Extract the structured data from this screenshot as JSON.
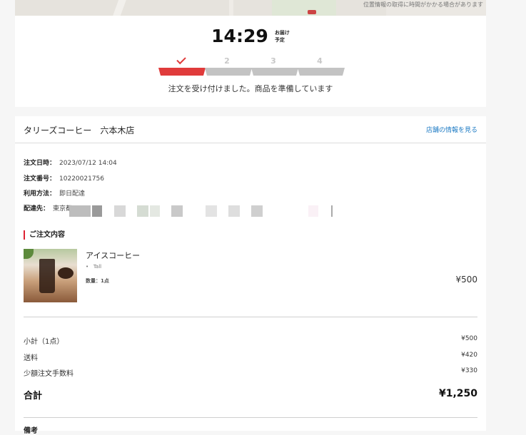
{
  "map": {
    "notice": "位置情報の取得に時間がかかる場合があります"
  },
  "status": {
    "time": "14:29",
    "time_note_1": "お届け",
    "time_note_2": "予定",
    "steps": [
      {
        "label": "✓",
        "active": true
      },
      {
        "label": "2",
        "active": false
      },
      {
        "label": "3",
        "active": false
      },
      {
        "label": "4",
        "active": false
      }
    ],
    "message": "注文を受け付けました。商品を準備しています"
  },
  "store": {
    "name": "タリーズコーヒー　六本木店",
    "link": "店舗の情報を見る"
  },
  "order_info": {
    "date_label": "注文日時：",
    "date_value": "2023/07/12 14:04",
    "number_label": "注文番号：",
    "number_value": "10220021756",
    "method_label": "利用方法：",
    "method_value": "即日配達",
    "address_label": "配達先：",
    "address_value": "東京都"
  },
  "items_section": {
    "title": "ご注文内容",
    "items": [
      {
        "name": "アイスコーヒー",
        "option": "Tall",
        "quantity": "数量：1点",
        "price": "¥500"
      }
    ]
  },
  "summary": {
    "subtotal_label": "小計（1点）",
    "subtotal_value": "¥500",
    "shipping_label": "送料",
    "shipping_value": "¥420",
    "small_fee_label": "少額注文手数料",
    "small_fee_value": "¥330",
    "total_label": "合計",
    "total_value": "¥1,250"
  },
  "memo": {
    "label": "備考"
  },
  "colors": {
    "accent": "#e03b3b",
    "link": "#1e7bc4",
    "inactive": "#c3c3c3"
  }
}
